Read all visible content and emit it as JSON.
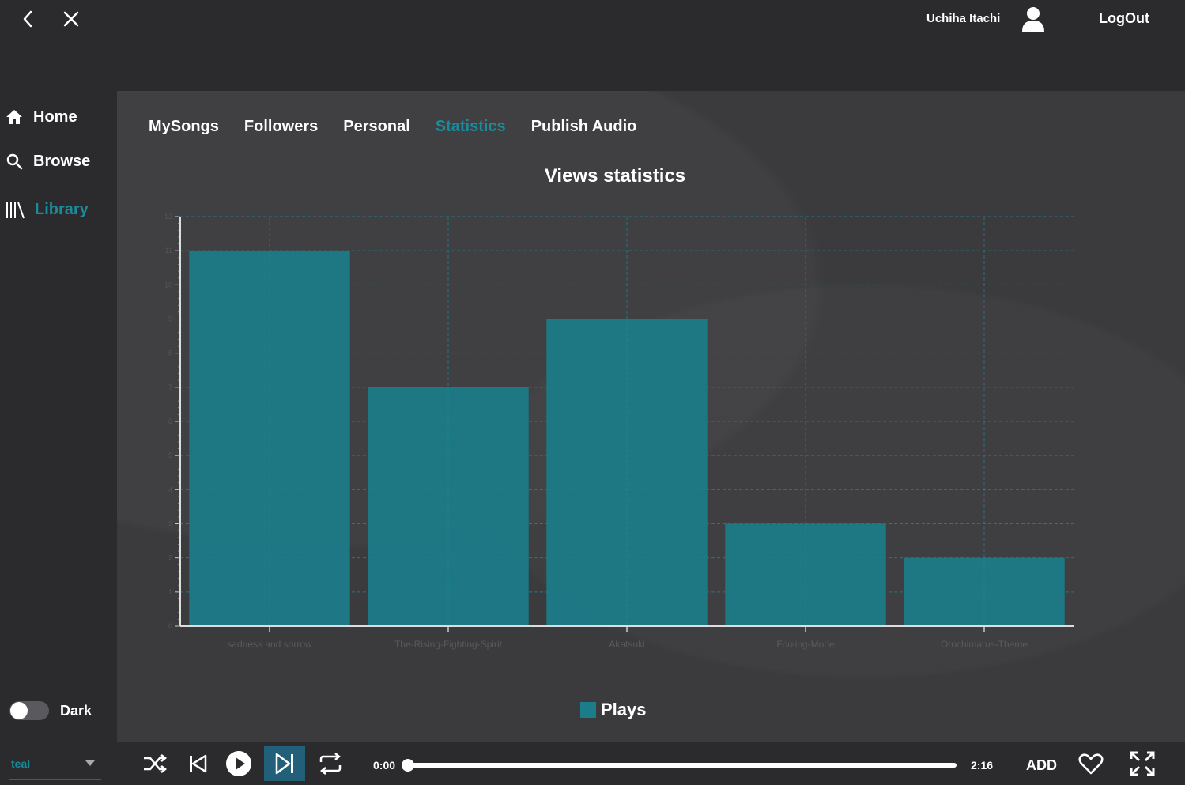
{
  "header": {
    "username": "Uchiha Itachi",
    "logout_label": "LogOut"
  },
  "sidebar": {
    "items": [
      {
        "label": "Home",
        "icon": "home-icon"
      },
      {
        "label": "Browse",
        "icon": "search-icon"
      },
      {
        "label": "Library",
        "icon": "library-icon",
        "active": true
      }
    ],
    "theme_toggle_label": "Dark"
  },
  "tabs": [
    {
      "label": "MySongs"
    },
    {
      "label": "Followers"
    },
    {
      "label": "Personal"
    },
    {
      "label": "Statistics",
      "active": true
    },
    {
      "label": "Publish Audio"
    }
  ],
  "chart_data": {
    "type": "bar",
    "title": "Views statistics",
    "categories": [
      "sadness and sorrow",
      "The-Rising-Fighting-Spirit",
      "Akatsuki",
      "Fooling-Mode",
      "Orochimarus-Theme"
    ],
    "series": [
      {
        "name": "Plays",
        "values": [
          11,
          7,
          9,
          3,
          2
        ]
      }
    ],
    "ylim": [
      0,
      12
    ],
    "yticks": [
      0,
      1,
      2,
      3,
      4,
      5,
      6,
      7,
      8,
      9,
      10,
      11,
      12
    ],
    "grid": true,
    "legend_position": "bottom",
    "bar_color": "#1b7d8a",
    "grid_color": "#1b8a9a"
  },
  "player": {
    "theme_value": "teal",
    "current_time": "0:00",
    "total_time": "2:16",
    "progress": 0,
    "add_label": "ADD"
  },
  "colors": {
    "accent": "#1b8a9a",
    "background": "#2b2b2e",
    "panel": "#3b3b3e"
  }
}
